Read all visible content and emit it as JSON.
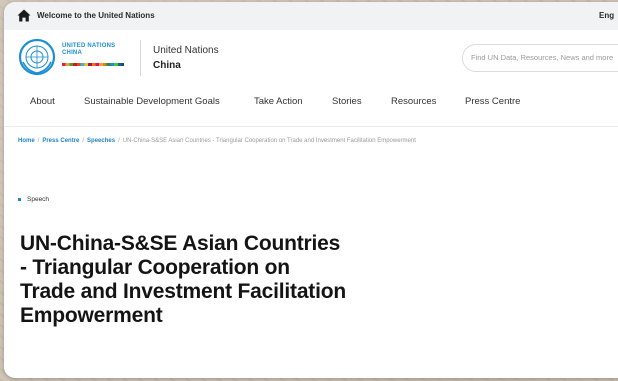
{
  "topbar": {
    "welcome": "Welcome to the United Nations",
    "language": "Eng"
  },
  "brand": {
    "logo_line1": "UNITED NATIONS",
    "logo_line2": "CHINA",
    "site_name": "United Nations",
    "site_sub": "China"
  },
  "search": {
    "placeholder": "Find UN Data, Resources, News and more"
  },
  "nav": {
    "items": [
      "About",
      "Sustainable Development Goals",
      "Take Action",
      "Stories",
      "Resources",
      "Press Centre"
    ]
  },
  "breadcrumb": {
    "home": "Home",
    "press": "Press Centre",
    "speeches": "Speeches",
    "current": "UN-China-S&SE Asian Countries - Triangular Cooperation on Trade and Investment Facilitation Empowerment"
  },
  "article": {
    "tag": "Speech",
    "title": "UN-China-S&SE Asian Countries - Triangular Cooperation on Trade and Investment Facilitation Empowerment"
  },
  "colors": {
    "accent": "#1e86c8",
    "topbar_bg": "#f1f2f4",
    "backdrop": "#cfc5b6"
  }
}
